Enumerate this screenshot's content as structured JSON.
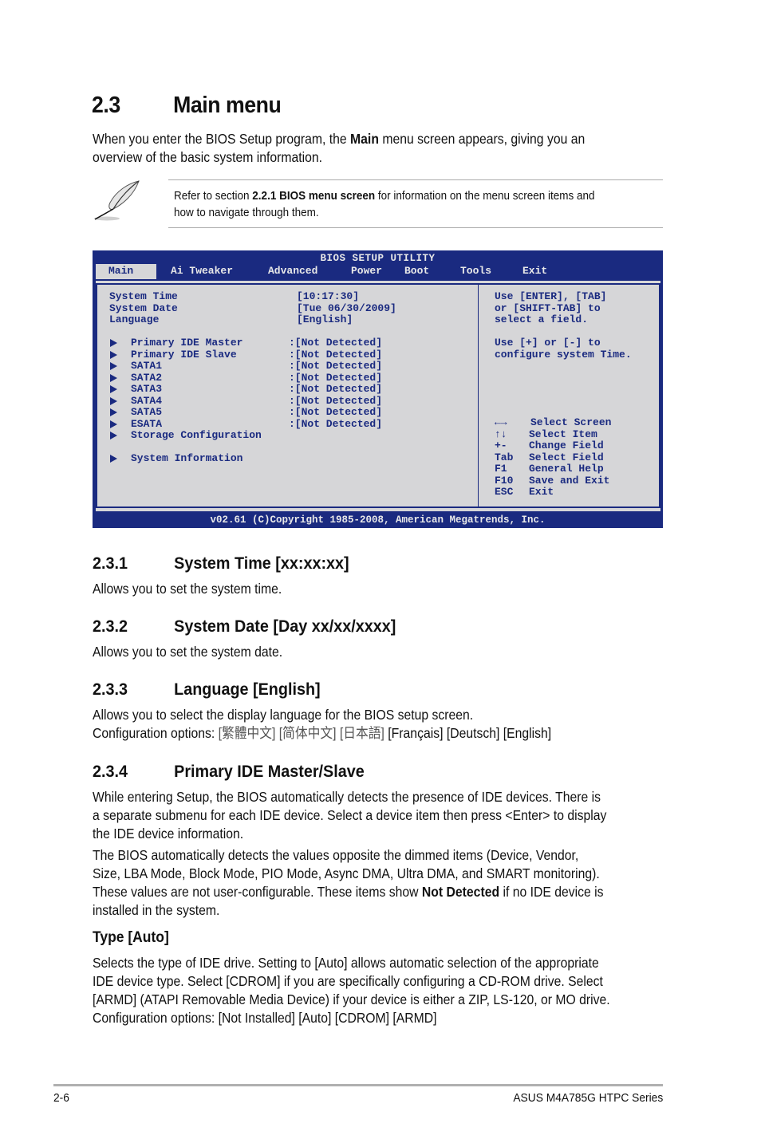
{
  "section": {
    "number": "2.3",
    "title": "Main menu",
    "intro_pre": "When you enter the BIOS Setup program, the ",
    "intro_bold": "Main",
    "intro_post": " menu screen appears, giving you an",
    "intro_line2": "overview of the basic system information."
  },
  "note": {
    "icon": "feather-pen-icon",
    "line1_pre": "Refer to section ",
    "line1_bold": "2.2.1 BIOS menu screen",
    "line1_post": " for information on the menu screen items and",
    "line2": "how to navigate through them."
  },
  "bios": {
    "title": "BIOS SETUP UTILITY",
    "tabs": [
      {
        "label": "Main",
        "active": true
      },
      {
        "label": "Ai Tweaker",
        "active": false
      },
      {
        "label": "Advanced",
        "active": false
      },
      {
        "label": "Power",
        "active": false
      },
      {
        "label": "Boot",
        "active": false
      },
      {
        "label": "Tools",
        "active": false
      },
      {
        "label": "Exit",
        "active": false
      }
    ],
    "settings": [
      {
        "label": "System Time",
        "value": "[10:17:30]"
      },
      {
        "label": "System Date",
        "value": "[Tue 06/30/2009]"
      },
      {
        "label": "Language",
        "value": "[English]"
      }
    ],
    "submenus": [
      {
        "label": "Primary IDE Master",
        "value": ":[Not Detected]"
      },
      {
        "label": "Primary IDE Slave",
        "value": ":[Not Detected]"
      },
      {
        "label": "SATA1",
        "value": ":[Not Detected]"
      },
      {
        "label": "SATA2",
        "value": ":[Not Detected]"
      },
      {
        "label": "SATA3",
        "value": ":[Not Detected]"
      },
      {
        "label": "SATA4",
        "value": ":[Not Detected]"
      },
      {
        "label": "SATA5",
        "value": ":[Not Detected]"
      },
      {
        "label": "ESATA",
        "value": ":[Not Detected]"
      },
      {
        "label": "Storage Configuration",
        "value": ""
      }
    ],
    "system_info": {
      "label": "System Information"
    },
    "help": {
      "lines": [
        "Use [ENTER], [TAB]",
        "or [SHIFT-TAB] to",
        "select a field."
      ],
      "lines2": [
        "Use [+] or [-] to",
        "configure system Time."
      ]
    },
    "keys": [
      {
        "key": "←→",
        "action": "Select Screen"
      },
      {
        "key": "↑↓",
        "action": "Select Item"
      },
      {
        "key": "+-",
        "action": "Change Field"
      },
      {
        "key": "Tab",
        "action": "Select Field"
      },
      {
        "key": "F1",
        "action": "General Help"
      },
      {
        "key": "F10",
        "action": "Save and Exit"
      },
      {
        "key": "ESC",
        "action": "Exit"
      }
    ],
    "footer": "v02.61 (C)Copyright 1985-2008, American Megatrends, Inc.",
    "colors": {
      "frame": "#1a2a80",
      "panel": "#d6d6d8",
      "header_text": "#e8e8e8"
    }
  },
  "subsections": {
    "s231": {
      "number": "2.3.1",
      "title": "System Time [xx:xx:xx]",
      "text": "Allows you to set the system time."
    },
    "s232": {
      "number": "2.3.2",
      "title": "System Date [Day xx/xx/xxxx]",
      "text": "Allows you to set the system date."
    },
    "s233": {
      "number": "2.3.3",
      "title": "Language [English]",
      "text": "Allows you to select the display language for the BIOS setup screen.",
      "options_label": "Configuration options: ",
      "options_cjk": [
        "[繁體中文]",
        "[简体中文]",
        "[日本語]"
      ],
      "options_latin": "[Français] [Deutsch] [English]"
    },
    "s234": {
      "number": "2.3.4",
      "title": "Primary IDE Master/Slave",
      "p1": [
        "While entering Setup, the BIOS automatically detects the presence of IDE devices. There is",
        "a separate submenu for each IDE device. Select a device item then press <Enter> to display",
        "the IDE device information."
      ],
      "p2": [
        "The BIOS automatically detects the values opposite the dimmed items (Device, Vendor,",
        "Size, LBA Mode, Block Mode, PIO Mode, Async DMA, Ultra DMA, and SMART monitoring)."
      ],
      "p2_line3_pre": "These values are not user-configurable. These items show ",
      "p2_line3_bold": "Not Detected",
      "p2_line3_post": " if no IDE device is",
      "p2_line4": "installed in the system."
    },
    "type": {
      "title": "Type [Auto]",
      "lines": [
        "Selects the type of IDE drive. Setting to [Auto] allows automatic selection of the appropriate",
        "IDE device type. Select [CDROM] if you are specifically configuring a CD-ROM drive. Select",
        "[ARMD] (ATAPI Removable Media Device) if your device is either a ZIP, LS-120, or MO drive.",
        "Configuration options: [Not Installed] [Auto] [CDROM] [ARMD]"
      ]
    }
  },
  "footer": {
    "page": "2-6",
    "product": "ASUS M4A785G HTPC Series"
  }
}
